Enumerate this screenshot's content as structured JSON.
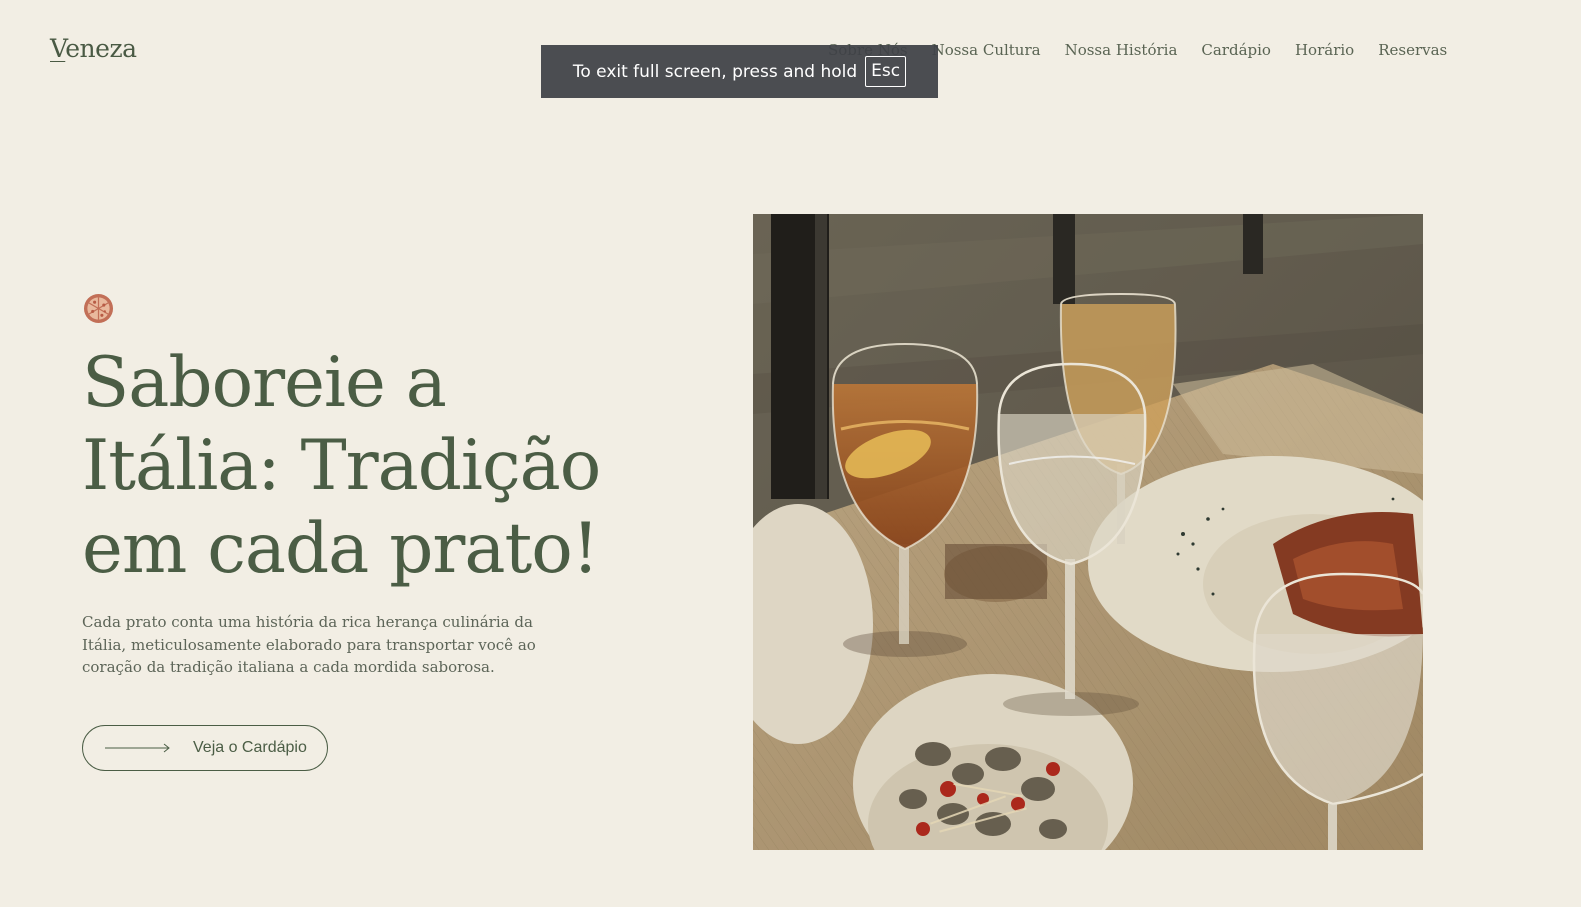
{
  "brand": {
    "logo_initial": "V",
    "logo_rest": "eneza"
  },
  "nav": {
    "items": [
      {
        "label": "Sobre Nós"
      },
      {
        "label": "Nossa Cultura"
      },
      {
        "label": "Nossa História"
      },
      {
        "label": "Cardápio"
      },
      {
        "label": "Horário"
      },
      {
        "label": "Reservas"
      }
    ]
  },
  "fullscreen_notice": {
    "text": "To exit full screen, press and hold",
    "key": "Esc"
  },
  "hero": {
    "icon": "pizza-icon",
    "headline": "Saboreie a Itália: Tradição em cada prato!",
    "description": "Cada prato conta uma história da rica herança culinária da Itália, meticulosamente elaborado para transportar você ao coração da tradição italiana a cada mordida saborosa.",
    "cta_label": "Veja o Cardápio",
    "cta_icon": "arrow-right-icon"
  },
  "colors": {
    "background": "#f2eee4",
    "accent": "#4b5d45",
    "icon": "#c26f57"
  }
}
